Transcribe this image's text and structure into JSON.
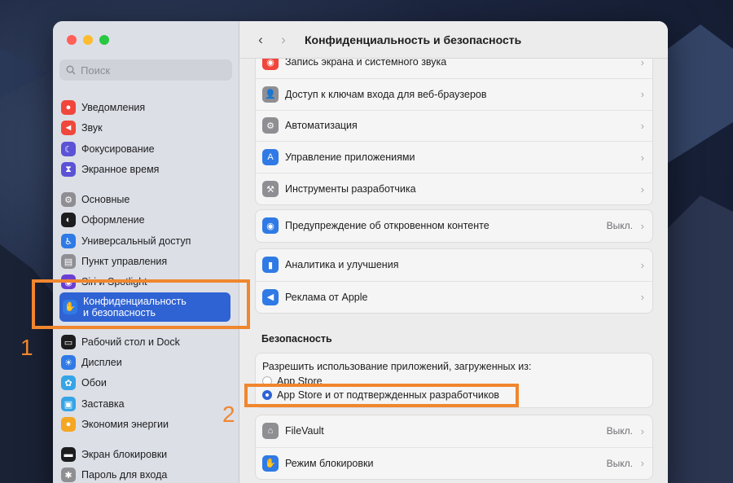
{
  "search": {
    "placeholder": "Поиск"
  },
  "title": "Конфиденциальность и безопасность",
  "sidebar": {
    "items": [
      {
        "label": "Уведомления",
        "color": "#f0463c",
        "icon": "bell-icon"
      },
      {
        "label": "Звук",
        "color": "#f0463c",
        "icon": "speaker-icon"
      },
      {
        "label": "Фокусирование",
        "color": "#5b52d6",
        "icon": "moon-icon"
      },
      {
        "label": "Экранное время",
        "color": "#5b52d6",
        "icon": "hourglass-icon"
      },
      {
        "label": "Основные",
        "color": "#8e8e93",
        "icon": "gear-icon"
      },
      {
        "label": "Оформление",
        "color": "#1d1d1f",
        "icon": "appearance-icon"
      },
      {
        "label": "Универсальный доступ",
        "color": "#2f7ae5",
        "icon": "accessibility-icon"
      },
      {
        "label": "Пункт управления",
        "color": "#8e8e93",
        "icon": "control-center-icon"
      },
      {
        "label": "Siri и Spotlight",
        "color": "#6b3fd4",
        "icon": "siri-icon"
      },
      {
        "label_line1": "Конфиденциальность",
        "label_line2": "и безопасность",
        "color": "#2f7ae5",
        "icon": "hand-icon"
      },
      {
        "label": "Рабочий стол и Dock",
        "color": "#1d1d1f",
        "icon": "dock-icon"
      },
      {
        "label": "Дисплеи",
        "color": "#2f7ae5",
        "icon": "sun-icon"
      },
      {
        "label": "Обои",
        "color": "#36a4e6",
        "icon": "flower-icon"
      },
      {
        "label": "Заставка",
        "color": "#36a4e6",
        "icon": "screensaver-icon"
      },
      {
        "label": "Экономия энергии",
        "color": "#f5a623",
        "icon": "bulb-icon"
      },
      {
        "label": "Экран блокировки",
        "color": "#1d1d1f",
        "icon": "lock-screen-icon"
      },
      {
        "label": "Пароль для входа",
        "color": "#8e8e93",
        "icon": "password-icon"
      }
    ]
  },
  "group1": [
    {
      "label": "Запись экрана и системного звука",
      "color": "#f0463c",
      "icon": "record-icon"
    },
    {
      "label": "Доступ к ключам входа для веб-браузеров",
      "color": "#8e8e93",
      "icon": "person-key-icon"
    },
    {
      "label": "Автоматизация",
      "color": "#8e8e93",
      "icon": "gears-icon"
    },
    {
      "label": "Управление приложениями",
      "color": "#2f7ae5",
      "icon": "app-store-icon"
    },
    {
      "label": "Инструменты разработчика",
      "color": "#8e8e93",
      "icon": "hammer-icon"
    }
  ],
  "sensitive": {
    "label": "Предупреждение об откровенном контенте",
    "value": "Выкл.",
    "color": "#2f7ae5",
    "icon": "eye-icon"
  },
  "group3": [
    {
      "label": "Аналитика и улучшения",
      "color": "#2f7ae5",
      "icon": "chart-icon"
    },
    {
      "label": "Реклама от Apple",
      "color": "#2f7ae5",
      "icon": "megaphone-icon"
    }
  ],
  "security": {
    "heading": "Безопасность",
    "allow_label": "Разрешить использование приложений, загруженных из:",
    "option1": "App Store",
    "option2": "App Store и от подтвержденных разработчиков"
  },
  "group5": [
    {
      "label": "FileVault",
      "value": "Выкл.",
      "color": "#8e8e93",
      "icon": "filevault-icon"
    },
    {
      "label": "Режим блокировки",
      "value": "Выкл.",
      "color": "#2f7ae5",
      "icon": "hand-icon"
    }
  ],
  "annotations": {
    "n1": "1",
    "n2": "2"
  },
  "accent": "#f0862e"
}
